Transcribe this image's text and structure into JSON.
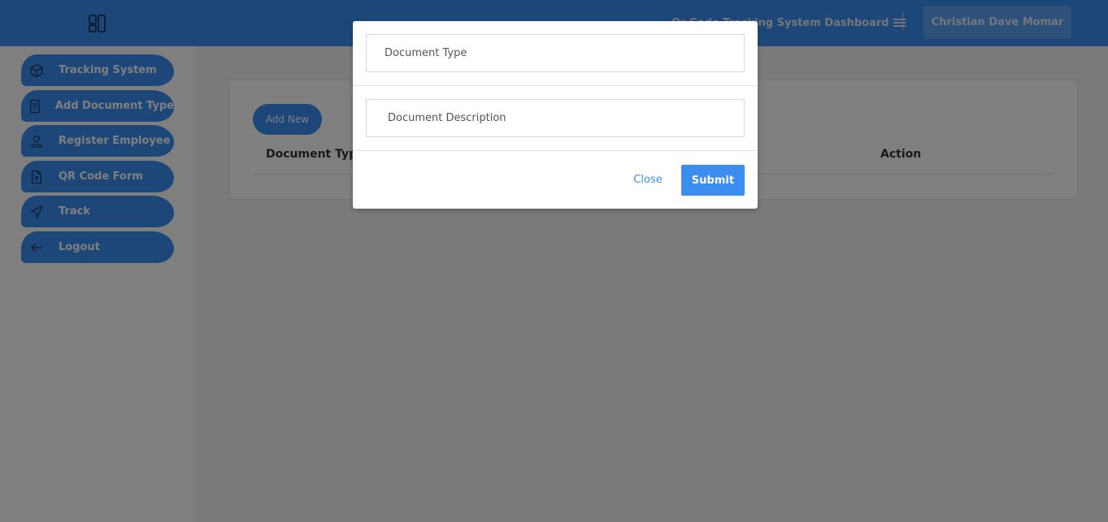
{
  "header": {
    "title": "Qr Code Tracking System Dashboard",
    "user_name": "Christian Dave Momar"
  },
  "sidebar": {
    "items": [
      {
        "label": "Tracking System",
        "icon": "cube-icon"
      },
      {
        "label": "Add Document Type",
        "icon": "document-icon"
      },
      {
        "label": "Register Employee",
        "icon": "user-icon"
      },
      {
        "label": "QR Code Form",
        "icon": "file-upload-icon"
      },
      {
        "label": "Track",
        "icon": "send-icon"
      },
      {
        "label": "Logout",
        "icon": "arrow-left-icon"
      }
    ]
  },
  "main": {
    "add_new_label": "Add New",
    "table": {
      "headers": [
        "Document Type",
        "Action"
      ]
    }
  },
  "modal": {
    "document_type_placeholder": "Document Type",
    "document_description_placeholder": "Document Description",
    "close_label": "Close",
    "submit_label": "Submit"
  },
  "colors": {
    "primary": "#3b8ef0",
    "overlay": "rgba(0,0,0,0.5)"
  }
}
